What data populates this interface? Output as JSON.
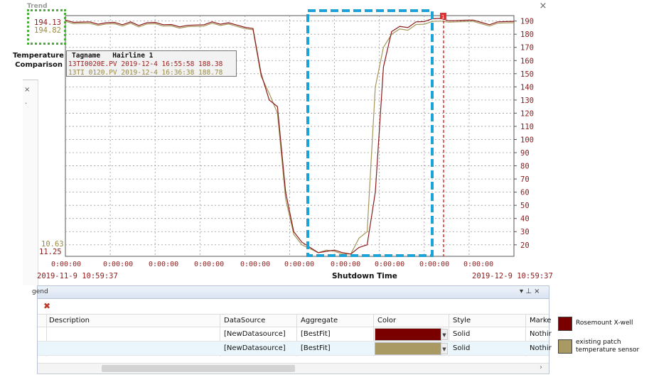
{
  "window": {
    "title": "Trend",
    "close_glyph": "×"
  },
  "readouts": {
    "max_red": "194.13",
    "max_olive": "194.82",
    "min_olive": "10.63",
    "min_red": "11.25"
  },
  "annotation": {
    "temperature_comparison": "Temperature Comparison",
    "shutdown_time": "Shutdown Time"
  },
  "hairline_box": {
    "header": "Tagname   Hairline 1",
    "rows": [
      "13TI0020E.PV 2019-12-4 16:55:58 188.38",
      "13TI_0120.PV 2019-12-4 16:36:38 188.78"
    ]
  },
  "colors": {
    "series_red": "#8b1a1a",
    "series_olive": "#a5965a",
    "box_blue": "#1aa3d8",
    "box_green": "#4cae3a",
    "hairline": "#e03030"
  },
  "chart_data": {
    "type": "line",
    "y_axis_ticks": [
      20,
      30,
      40,
      50,
      60,
      70,
      80,
      90,
      100,
      110,
      120,
      130,
      140,
      150,
      160,
      170,
      180,
      190
    ],
    "ylim": [
      11.25,
      194.13
    ],
    "x_tick_labels": [
      "0:00:00",
      "0:00:00",
      "0:00:00",
      "0:00:00",
      "0:00:00",
      "0:00:00",
      "0:00:00",
      "0:00:00",
      "0:00:00",
      "0:00:00"
    ],
    "x_range": [
      "2019-11-9 10:59:37",
      "2019-12-9 10:59:37"
    ],
    "grid": true,
    "hairline_marker": "1",
    "series": [
      {
        "color": "#8b1a1a",
        "values": [
          190,
          189,
          190,
          189,
          188,
          188,
          189,
          188,
          189,
          187,
          188,
          189,
          188,
          187,
          186,
          186,
          187,
          188,
          189,
          188,
          188,
          187,
          186,
          184,
          150,
          130,
          125,
          60,
          30,
          22,
          18,
          14,
          15,
          16,
          14,
          13,
          18,
          20,
          60,
          155,
          182,
          186,
          185,
          189,
          190,
          191,
          192,
          191,
          190,
          191,
          190,
          189,
          188,
          189,
          190,
          189
        ]
      },
      {
        "color": "#a5965a",
        "values": [
          189,
          188,
          189,
          188,
          187,
          187,
          188,
          187,
          188,
          186,
          187,
          188,
          187,
          186,
          185,
          185,
          186,
          187,
          188,
          187,
          187,
          186,
          185,
          183,
          148,
          135,
          120,
          55,
          28,
          20,
          17,
          14,
          16,
          15,
          13,
          13,
          25,
          30,
          140,
          170,
          180,
          184,
          183,
          187,
          188,
          189,
          190,
          190,
          189,
          190,
          189,
          188,
          187,
          188,
          189,
          188
        ]
      }
    ]
  },
  "legend": {
    "title": "gend",
    "pin_glyphs": "▾ ⊥ ×",
    "delete_glyph": "✖",
    "columns": [
      "Description",
      "DataSource",
      "Aggregate",
      "Color",
      "Style",
      "Marke"
    ],
    "rows": [
      {
        "description": "",
        "datasource": "[NewDatasource]",
        "aggregate": "[BestFit]",
        "color": "#7a0000",
        "style": "Solid",
        "marker": "Nothir"
      },
      {
        "description": "",
        "datasource": "[NewDatasource]",
        "aggregate": "[BestFit]",
        "color": "#a89a62",
        "style": "Solid",
        "marker": "Nothir"
      }
    ],
    "scroll_arrow": "›"
  },
  "side_legend": [
    {
      "color": "#7a0000",
      "label": "Rosemount X-well"
    },
    {
      "color": "#a89a62",
      "label": "existing patch temperature sensor"
    }
  ]
}
